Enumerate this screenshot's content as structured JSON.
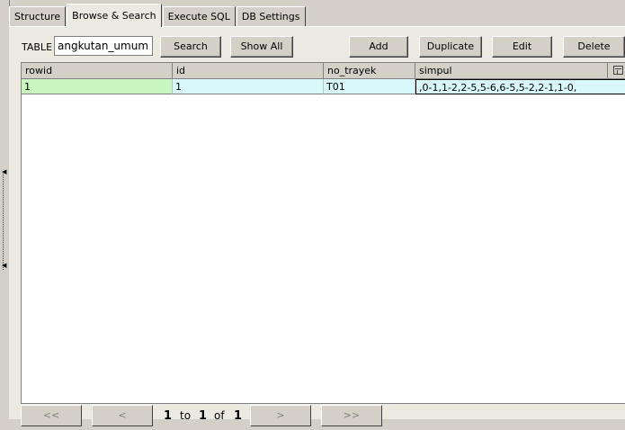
{
  "tabs": [
    "Structure",
    "Browse & Search",
    "Execute SQL",
    "DB Settings"
  ],
  "toolbar": {
    "table_label": "TABLE",
    "table_value": "angkutan_umum",
    "search_label": "Search",
    "show_all_label": "Show All",
    "add_label": "Add",
    "duplicate_label": "Duplicate",
    "edit_label": "Edit",
    "delete_label": "Delete"
  },
  "grid": {
    "columns": [
      "rowid",
      "id",
      "no_trayek",
      "simpul"
    ],
    "rows": [
      [
        "1",
        "1",
        "T01",
        ",0-1,1-2,2-5,5-6,6-5,5-2,2-1,1-0,"
      ]
    ]
  },
  "pager": {
    "first_label": "<<",
    "prev_label": "<",
    "next_label": ">",
    "last_label": ">>",
    "from": "1",
    "to_word": "to",
    "to": "1",
    "of_word": "of",
    "total": "1"
  },
  "colors": {
    "window_bg": "#d4d0c8",
    "panel_bg": "#ece9e0",
    "rowid_cell_bg": "#c8f5c0",
    "data_cell_bg": "#d8f8fc"
  }
}
